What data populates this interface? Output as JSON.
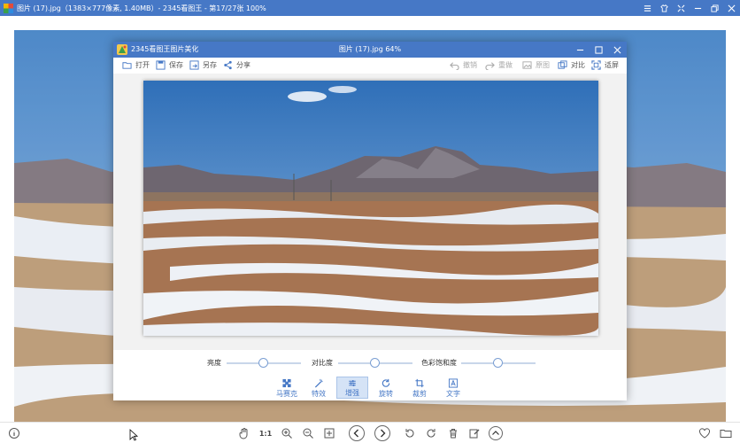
{
  "window": {
    "title": "图片 (17).jpg（1383×777像素, 1.40MB）- 2345看图王 - 第17/27张 100%"
  },
  "dialog": {
    "app_name": "2345看图王图片美化",
    "file_info": "图片 (17).jpg   64%",
    "toolbar": {
      "open": "打开",
      "save": "保存",
      "save_as": "另存",
      "share": "分享",
      "undo": "撤销",
      "redo": "重做",
      "original": "原图",
      "compare": "对比",
      "fit": "适屏"
    },
    "sliders": [
      {
        "label": "亮度",
        "value": 0.5
      },
      {
        "label": "对比度",
        "value": 0.5
      },
      {
        "label": "色彩饱和度",
        "value": 0.5
      }
    ],
    "tools": [
      {
        "label": "马赛克",
        "icon": "mosaic-icon"
      },
      {
        "label": "特效",
        "icon": "magic-wand-icon"
      },
      {
        "label": "增强",
        "icon": "adjust-icon",
        "active": true
      },
      {
        "label": "旋转",
        "icon": "rotate-icon"
      },
      {
        "label": "裁剪",
        "icon": "crop-icon"
      },
      {
        "label": "文字",
        "icon": "text-icon"
      }
    ]
  },
  "bottombar": {
    "ratio_label": "1:1"
  },
  "colors": {
    "accent": "#4678c6",
    "sky": "#4a86c8",
    "snow": "#eef2f7",
    "soil": "#9a6a45"
  }
}
